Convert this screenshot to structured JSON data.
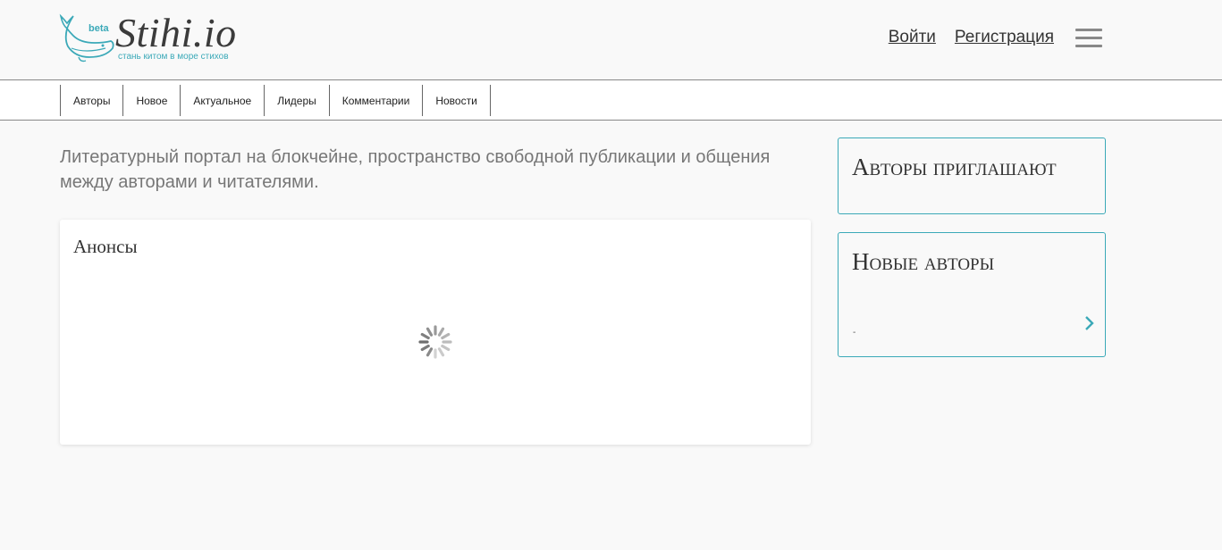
{
  "header": {
    "logo": {
      "beta": "beta",
      "name": "Stihi.io",
      "tagline": "стань китом в море стихов"
    },
    "login_label": "Войти",
    "register_label": "Регистрация",
    "menu_icon": "hamburger-menu-icon"
  },
  "nav": {
    "items": [
      {
        "label": "Авторы"
      },
      {
        "label": "Новое"
      },
      {
        "label": "Актуальное"
      },
      {
        "label": "Лидеры"
      },
      {
        "label": "Комментарии"
      },
      {
        "label": "Новости"
      }
    ]
  },
  "main": {
    "intro": "Литературный портал на блокчейне, пространство свободной публикации и общения между авторами и читателями.",
    "announcements_title": "Анонсы",
    "loading_icon": "loading-spinner-icon"
  },
  "sidebar": {
    "authors_invite_title": "Авторы приглашают",
    "new_authors_title": "Новые авторы",
    "new_authors_placeholder": "-",
    "next_icon": "chevron-right-icon"
  },
  "colors": {
    "accent": "#3ba9b8",
    "text": "#333333",
    "muted": "#777777",
    "background": "#f9f9f9"
  }
}
